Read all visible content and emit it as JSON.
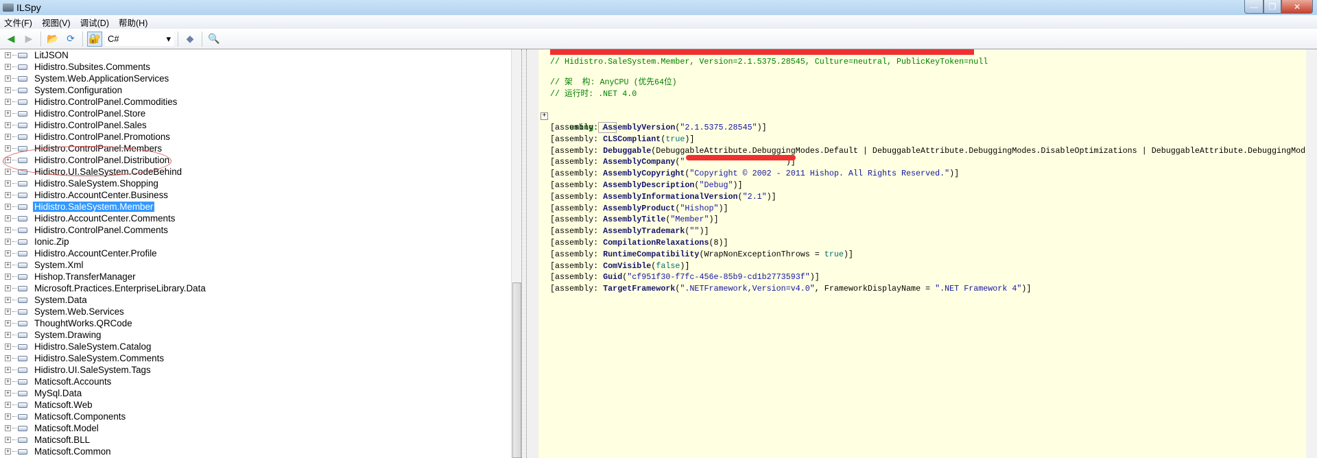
{
  "window": {
    "title": "ILSpy",
    "minimize": "—",
    "restore": "❐",
    "close": "✕"
  },
  "menu": [
    "文件(F)",
    "视图(V)",
    "调试(D)",
    "帮助(H)"
  ],
  "toolbar": {
    "back": "◀",
    "forward": "▶",
    "open": "📂",
    "reload": "⟳",
    "language": "C#",
    "dropdown": "▾",
    "search": "🔍"
  },
  "tree": {
    "selected": "Hidistro.SaleSystem.Member",
    "items": [
      "LitJSON",
      "Hidistro.Subsites.Comments",
      "System.Web.ApplicationServices",
      "System.Configuration",
      "Hidistro.ControlPanel.Commodities",
      "Hidistro.ControlPanel.Store",
      "Hidistro.ControlPanel.Sales",
      "Hidistro.ControlPanel.Promotions",
      "Hidistro.ControlPanel.Members",
      "Hidistro.ControlPanel.Distribution",
      "Hidistro.UI.SaleSystem.CodeBehind",
      "Hidistro.SaleSystem.Shopping",
      "Hidistro.AccountCenter.Business",
      "Hidistro.SaleSystem.Member",
      "Hidistro.AccountCenter.Comments",
      "Hidistro.ControlPanel.Comments",
      "Ionic.Zip",
      "Hidistro.AccountCenter.Profile",
      "System.Xml",
      "Hishop.TransferManager",
      "Microsoft.Practices.EnterpriseLibrary.Data",
      "System.Data",
      "System.Web.Services",
      "ThoughtWorks.QRCode",
      "System.Drawing",
      "Hidistro.SaleSystem.Catalog",
      "Hidistro.SaleSystem.Comments",
      "Hidistro.UI.SaleSystem.Tags",
      "Maticsoft.Accounts",
      "MySql.Data",
      "Maticsoft.Web",
      "Maticsoft.Components",
      "Maticsoft.Model",
      "Maticsoft.BLL",
      "Maticsoft.Common"
    ]
  },
  "colors": {
    "comment": "#008000",
    "keyword": "#008000",
    "type": "#14146e",
    "string": "#1515a3",
    "value": "#007070",
    "plain": "#000000"
  },
  "code": {
    "comment1": "// Hidistro.SaleSystem.Member, Version=2.1.5375.28545, Culture=neutral, PublicKeyToken=null",
    "comment2": "// 架  构: AnyCPU (优先64位)",
    "comment3": "// 运行时: .NET 4.0",
    "fold": "+",
    "using": "using",
    "ellipsis": "...",
    "lines": [
      [
        [
          "p",
          "[assembly: "
        ],
        [
          "t",
          "AssemblyVersion"
        ],
        [
          "p",
          "("
        ],
        [
          "s",
          "\"2.1.5375.28545\""
        ],
        [
          "p",
          ")]"
        ]
      ],
      [
        [
          "p",
          "[assembly: "
        ],
        [
          "t",
          "CLSCompliant"
        ],
        [
          "p",
          "("
        ],
        [
          "v",
          "true"
        ],
        [
          "p",
          ")]"
        ]
      ],
      [
        [
          "p",
          "[assembly: "
        ],
        [
          "t",
          "Debuggable"
        ],
        [
          "p",
          "(DebuggableAttribute.DebuggingModes.Default | DebuggableAttribute.DebuggingModes.DisableOptimizations | DebuggableAttribute.DebuggingModes.IgnoreSymbolStoreSequencePoints | DebuggableAttribute.DebuggingModes.EnableEditAndContinue)]"
        ]
      ],
      [
        [
          "p",
          "[assembly: "
        ],
        [
          "t",
          "AssemblyCompany"
        ],
        [
          "p",
          "("
        ],
        [
          "s",
          "\"                    \""
        ],
        [
          "p",
          ")]"
        ]
      ],
      [
        [
          "p",
          "[assembly: "
        ],
        [
          "t",
          "AssemblyCopyright"
        ],
        [
          "p",
          "("
        ],
        [
          "s",
          "\"Copyright © 2002 - 2011 Hishop. All Rights Reserved.\""
        ],
        [
          "p",
          ")]"
        ]
      ],
      [
        [
          "p",
          "[assembly: "
        ],
        [
          "t",
          "AssemblyDescription"
        ],
        [
          "p",
          "("
        ],
        [
          "s",
          "\"Debug\""
        ],
        [
          "p",
          ")]"
        ]
      ],
      [
        [
          "p",
          "[assembly: "
        ],
        [
          "t",
          "AssemblyInformationalVersion"
        ],
        [
          "p",
          "("
        ],
        [
          "s",
          "\"2.1\""
        ],
        [
          "p",
          ")]"
        ]
      ],
      [
        [
          "p",
          "[assembly: "
        ],
        [
          "t",
          "AssemblyProduct"
        ],
        [
          "p",
          "("
        ],
        [
          "s",
          "\"Hishop\""
        ],
        [
          "p",
          ")]"
        ]
      ],
      [
        [
          "p",
          "[assembly: "
        ],
        [
          "t",
          "AssemblyTitle"
        ],
        [
          "p",
          "("
        ],
        [
          "s",
          "\"Member\""
        ],
        [
          "p",
          ")]"
        ]
      ],
      [
        [
          "p",
          "[assembly: "
        ],
        [
          "t",
          "AssemblyTrademark"
        ],
        [
          "p",
          "("
        ],
        [
          "s",
          "\"\""
        ],
        [
          "p",
          ")]"
        ]
      ],
      [
        [
          "p",
          "[assembly: "
        ],
        [
          "t",
          "CompilationRelaxations"
        ],
        [
          "p",
          "(8)]"
        ]
      ],
      [
        [
          "p",
          "[assembly: "
        ],
        [
          "t",
          "RuntimeCompatibility"
        ],
        [
          "p",
          "(WrapNonExceptionThrows = "
        ],
        [
          "v",
          "true"
        ],
        [
          "p",
          ")]"
        ]
      ],
      [
        [
          "p",
          "[assembly: "
        ],
        [
          "t",
          "ComVisible"
        ],
        [
          "p",
          "("
        ],
        [
          "v",
          "false"
        ],
        [
          "p",
          ")]"
        ]
      ],
      [
        [
          "p",
          "[assembly: "
        ],
        [
          "t",
          "Guid"
        ],
        [
          "p",
          "("
        ],
        [
          "s",
          "\"cf951f30-f7fc-456e-85b9-cd1b2773593f\""
        ],
        [
          "p",
          ")]"
        ]
      ],
      [
        [
          "p",
          "[assembly: "
        ],
        [
          "t",
          "TargetFramework"
        ],
        [
          "p",
          "("
        ],
        [
          "s",
          "\".NETFramework,Version=v4.0\""
        ],
        [
          "p",
          ", FrameworkDisplayName = "
        ],
        [
          "s",
          "\".NET Framework 4\""
        ],
        [
          "p",
          ")]"
        ]
      ]
    ]
  }
}
